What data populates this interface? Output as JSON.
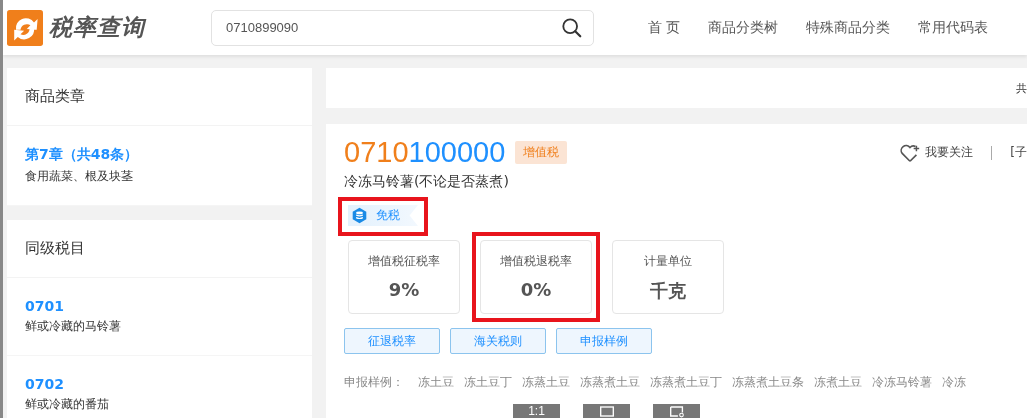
{
  "header": {
    "logo_text": "税率查询",
    "search": {
      "value": "0710899090"
    },
    "nav": [
      {
        "label": "首 页"
      },
      {
        "label": "商品分类树"
      },
      {
        "label": "特殊商品分类"
      },
      {
        "label": "常用代码表"
      }
    ]
  },
  "sidebar": [
    {
      "title": "商品类章",
      "items": [
        {
          "code": "第7章（共48条）",
          "desc": "食用蔬菜、根及块茎"
        }
      ]
    },
    {
      "title": "同级税目",
      "items": [
        {
          "code": "0701",
          "desc": "鲜或冷藏的马铃薯"
        },
        {
          "code": "0702",
          "desc": "鲜或冷藏的番茄"
        }
      ]
    }
  ],
  "summary_bar": {
    "text": "共"
  },
  "product": {
    "code_matched": "0710",
    "code_rest": "100000",
    "tax_badge": "增值税",
    "follow": "我要关注",
    "extra_link": "[子",
    "name": "冷冻马铃薯(不论是否蒸煮)",
    "tag": {
      "label": "免税",
      "highlighted": true
    },
    "stats": [
      {
        "label": "增值税征税率",
        "value": "9%",
        "highlighted": false
      },
      {
        "label": "增值税退税率",
        "value": "0%",
        "highlighted": true
      },
      {
        "label": "计量单位",
        "value": "千克",
        "highlighted": false
      }
    ],
    "buttons": [
      "征退税率",
      "海关税则",
      "申报样例"
    ],
    "examples_label": "申报样例：",
    "examples": [
      "冻土豆",
      "冻土豆丁",
      "冻蒸土豆",
      "冻蒸煮土豆",
      "冻蒸煮土豆丁",
      "冻蒸煮土豆条",
      "冻煮土豆",
      "冷冻马铃薯",
      "冷冻"
    ]
  },
  "viewer_toolbar": {
    "zoom_label": "1:1"
  }
}
